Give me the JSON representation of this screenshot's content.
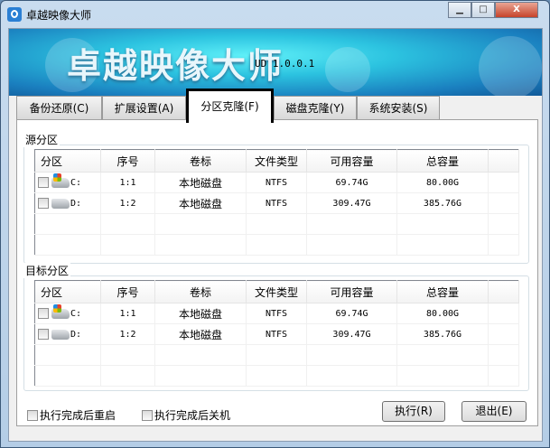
{
  "window": {
    "title": "卓越映像大师",
    "minimize": "▁",
    "maximize": "□",
    "close": "X"
  },
  "banner": {
    "title": "卓越映像大师",
    "version": "UD 1.0.0.1"
  },
  "tabs": [
    {
      "label": "备份还原(C)"
    },
    {
      "label": "扩展设置(A)"
    },
    {
      "label": "分区克隆(F)",
      "active": true
    },
    {
      "label": "磁盘克隆(Y)"
    },
    {
      "label": "系统安装(S)"
    }
  ],
  "columns": [
    "分区",
    "序号",
    "卷标",
    "文件类型",
    "可用容量",
    "总容量"
  ],
  "source": {
    "label": "源分区",
    "rows": [
      {
        "drive": "C:",
        "index": "1:1",
        "volume": "本地磁盘",
        "fs": "NTFS",
        "free": "69.74G",
        "total": "80.00G"
      },
      {
        "drive": "D:",
        "index": "1:2",
        "volume": "本地磁盘",
        "fs": "NTFS",
        "free": "309.47G",
        "total": "385.76G"
      }
    ]
  },
  "target": {
    "label": "目标分区",
    "rows": [
      {
        "drive": "C:",
        "index": "1:1",
        "volume": "本地磁盘",
        "fs": "NTFS",
        "free": "69.74G",
        "total": "80.00G"
      },
      {
        "drive": "D:",
        "index": "1:2",
        "volume": "本地磁盘",
        "fs": "NTFS",
        "free": "309.47G",
        "total": "385.76G"
      }
    ]
  },
  "options": {
    "reboot": "执行完成后重启",
    "shutdown": "执行完成后关机"
  },
  "buttons": {
    "execute": "执行(R)",
    "exit": "退出(E)"
  }
}
